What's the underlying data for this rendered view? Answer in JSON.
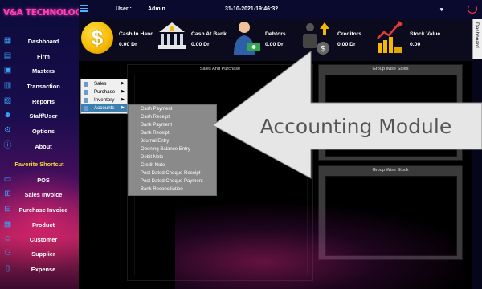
{
  "app": {
    "logo_text": "V&A TECHNOLOGIES"
  },
  "topbar": {
    "user_label": "User :",
    "user_name": "Admin",
    "datetime": "31-10-2021-19:46:32"
  },
  "sidebar": {
    "items": [
      {
        "label": "Dashboard",
        "icon": "dashboard-icon"
      },
      {
        "label": "Firm",
        "icon": "firm-icon"
      },
      {
        "label": "Masters",
        "icon": "masters-icon"
      },
      {
        "label": "Transaction",
        "icon": "transaction-icon"
      },
      {
        "label": "Reports",
        "icon": "reports-icon"
      },
      {
        "label": "Staff/User",
        "icon": "staff-user-icon"
      },
      {
        "label": "Options",
        "icon": "options-icon"
      },
      {
        "label": "About",
        "icon": "about-icon"
      }
    ],
    "favorite_label": "Favorite Shortcut",
    "shortcuts": [
      {
        "label": "POS",
        "icon": "pos-icon"
      },
      {
        "label": "Sales Invoice",
        "icon": "cart-icon"
      },
      {
        "label": "Purchase Invoice",
        "icon": "purchase-icon"
      },
      {
        "label": "Product",
        "icon": "product-icon"
      },
      {
        "label": "Customer",
        "icon": "customer-icon"
      },
      {
        "label": "Supplier",
        "icon": "supplier-icon"
      },
      {
        "label": "Expense",
        "icon": "expense-icon"
      }
    ]
  },
  "cards": [
    {
      "title": "Cash In Hand",
      "value": "0.00 Dr",
      "icon": "coin-icon"
    },
    {
      "title": "Cash At Bank",
      "value": "0.00 Dr",
      "icon": "bank-icon"
    },
    {
      "title": "Debtors",
      "value": "0.00 Dr",
      "icon": "debtors-icon"
    },
    {
      "title": "Creditors",
      "value": "0.00 Dr",
      "icon": "creditors-icon"
    },
    {
      "title": "Stock Value",
      "value": "0.00",
      "icon": "stock-chart-icon"
    }
  ],
  "dashboard_tab": "Dashboard",
  "panels": {
    "sales_purchase": "Sales And Purchase",
    "group_sales": "Group Wise Sales",
    "group_stock": "Group Wise Stock"
  },
  "menu_main": {
    "items": [
      {
        "label": "Sales"
      },
      {
        "label": "Purchase"
      },
      {
        "label": "Inventory"
      },
      {
        "label": "Accounts",
        "active": true
      }
    ]
  },
  "menu_accounts": {
    "items": [
      "Cash Payment",
      "Cash Receipt",
      "Bank Payment",
      "Bank Receipt",
      "Journal Entry",
      "Opening Balance Entry",
      "Debit Note",
      "Credit Note",
      "Post Dated Cheque Receipt",
      "Post Dated Cheque Payment",
      "Bank Reconciliation"
    ]
  },
  "callout": {
    "text": "Accounting Module"
  },
  "colors": {
    "accent_blue": "#3aa5ff",
    "favorite_yellow": "#f4d23a",
    "logo_pink": "#ff3fb3",
    "power_red": "#ff3b3b",
    "menu_highlight": "#3c7fb1"
  }
}
